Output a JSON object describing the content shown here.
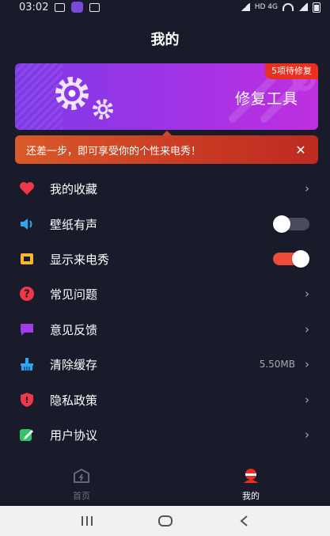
{
  "status_bar": {
    "time": "03:02",
    "network": "HD 4G"
  },
  "page": {
    "title": "我的"
  },
  "banner": {
    "title": "修复工具",
    "badge": "5项待修复"
  },
  "notice": {
    "text": "还差一步，即可享受你的个性来电秀！",
    "close": "✕"
  },
  "menu": {
    "items": [
      {
        "label": "我的收藏",
        "icon": "heart-icon",
        "color": "#f0384a"
      },
      {
        "label": "壁纸有声",
        "icon": "speaker-icon",
        "color": "#2aa8f2"
      },
      {
        "label": "显示来电秀",
        "icon": "film-icon",
        "color": "#f5b82e"
      },
      {
        "label": "常见问题",
        "icon": "question-icon",
        "color": "#f0384a"
      },
      {
        "label": "意见反馈",
        "icon": "chat-bubble-icon",
        "color": "#a03ce8"
      },
      {
        "label": "清除缓存",
        "icon": "broom-icon",
        "color": "#2aa8f2",
        "value": "5.50MB"
      },
      {
        "label": "隐私政策",
        "icon": "shield-icon",
        "color": "#f0384a"
      },
      {
        "label": "用户协议",
        "icon": "edit-icon",
        "color": "#33c46a"
      }
    ],
    "arrow": "›",
    "toggles": {
      "wallpaper_sound": false,
      "show_call_show": true
    }
  },
  "tabbar": {
    "home": "首页",
    "mine": "我的"
  },
  "colors": {
    "background": "#191b2b",
    "banner_start": "#7e3ae8",
    "banner_end": "#bf2fe0",
    "notice": "#c83a23",
    "toggle_on": "#f04a3a",
    "badge": "#e9301f"
  }
}
